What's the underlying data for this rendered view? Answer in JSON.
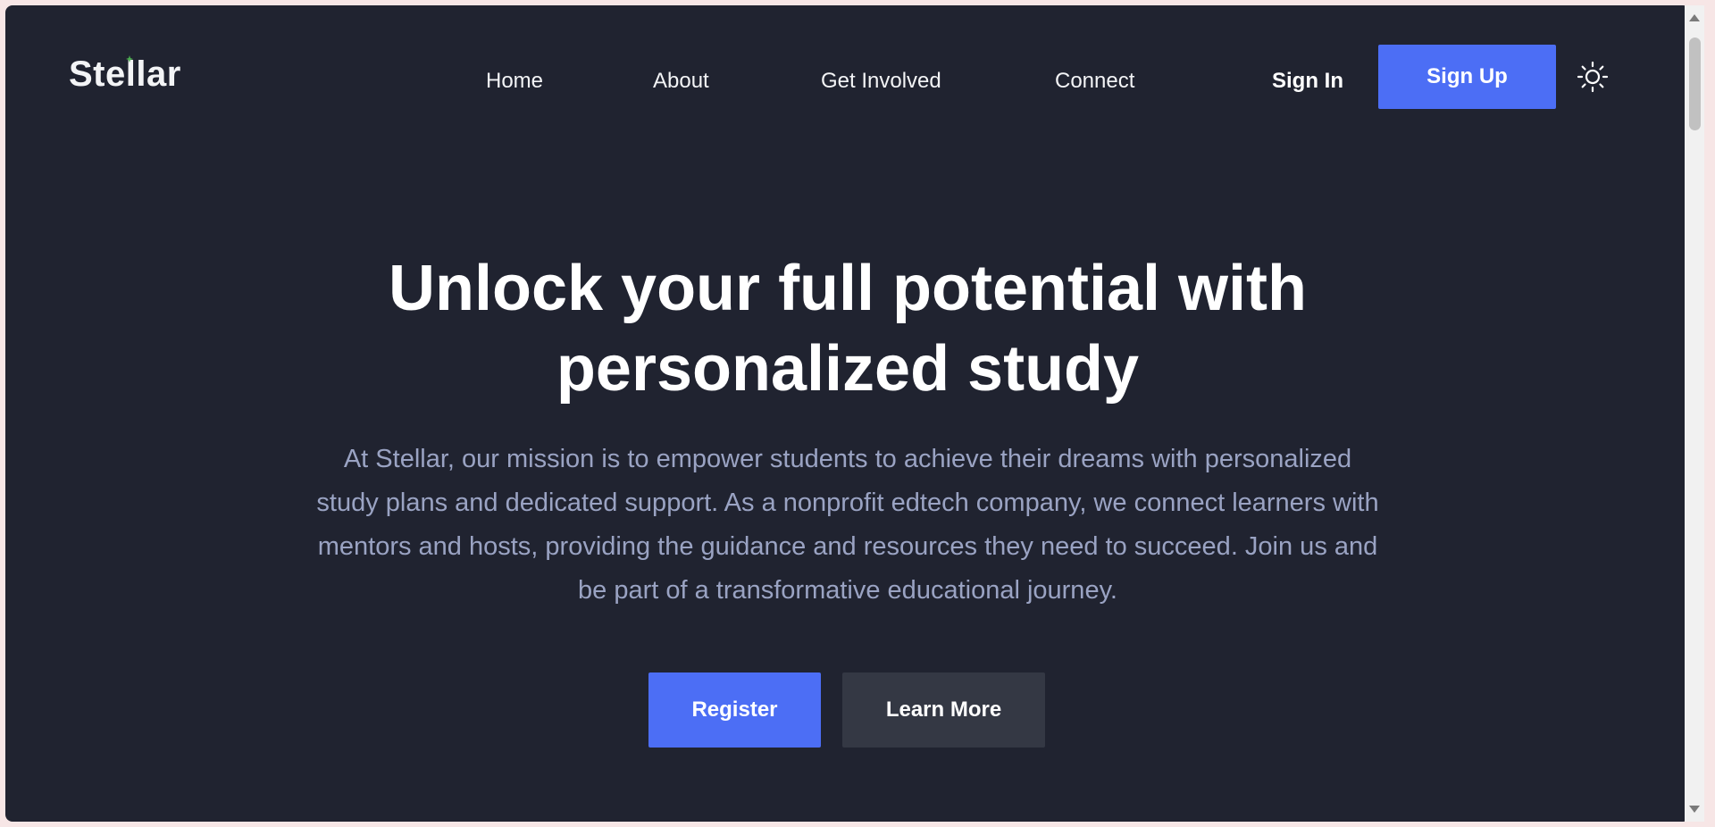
{
  "brand": {
    "name": "Stellar"
  },
  "nav": {
    "links": [
      {
        "label": "Home"
      },
      {
        "label": "About"
      },
      {
        "label": "Get Involved"
      },
      {
        "label": "Connect"
      }
    ],
    "sign_in": "Sign In",
    "sign_up": "Sign Up"
  },
  "hero": {
    "title_line1": "Unlock your full potential with",
    "title_line2": "personalized study",
    "description": "At Stellar, our mission is to empower students to achieve their dreams with personalized study plans and dedicated support. As a nonprofit edtech company, we connect learners with mentors and hosts, providing the guidance and resources they need to succeed. Join us and be part of a transformative educational journey.",
    "primary_button": "Register",
    "secondary_button": "Learn More"
  },
  "colors": {
    "background": "#202330",
    "accent": "#4c6ef5",
    "secondary_button": "#343844",
    "muted_text": "#9aa3c3",
    "sparkle": "#4caf50"
  },
  "icons": {
    "theme_toggle": "sun-icon",
    "logo_accent": "sparkle-icon"
  }
}
